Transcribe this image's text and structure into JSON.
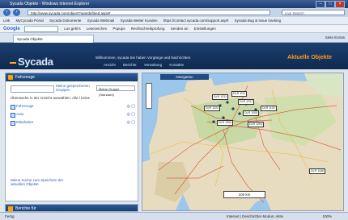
{
  "window": {
    "title": "Sycada Objekte - Windows Internet Explorer"
  },
  "address": {
    "url": "http://www.sycada.com/object?userdefined.aspx#",
    "live_search": "Live Search"
  },
  "links": [
    "Link",
    "MyCycada Portal",
    "Sycada Dokumente",
    "Sycada Webmail",
    "Sycada Weiter Kunden",
    "https://contact.sycada.com/support.asp#",
    "Sycada Bug & Issue tracking"
  ],
  "google_toolbar": {
    "label": "Google",
    "items": [
      "Los geht's",
      "Lesezeichen",
      "Popups",
      "Rechtschreibprüfung",
      "Senden an",
      "Einstellungen"
    ]
  },
  "tab": {
    "label": "Sycada Objekte",
    "tools": "Seite  Extras"
  },
  "app": {
    "logo": "Sycada",
    "welcome": "Willkommen, sycada   Sie haben Vorgänge und Nachrichten",
    "nav": [
      "Ansicht",
      "Berichte",
      "Verwaltung",
      "Kontakte"
    ],
    "headline": "Aktuelle Objekte"
  },
  "left_panel": {
    "title": "Fahrzeuge",
    "group_link": "Meine gespeicherten Gruppen",
    "group_select": "Meine Gruppe (Standard)",
    "list_heading": "Überwache in der Ansicht auswählen:  Alle / keine",
    "vehicles": [
      {
        "label": "Fahrzeuge",
        "actions": "◎ ▢"
      },
      {
        "label": "Auto",
        "actions": "◎ ▢"
      },
      {
        "label": "Mitarbeiter",
        "actions": "◎ ▢"
      }
    ],
    "save_link": "Meine Suche zum Speichern der aktuellen Objekte"
  },
  "bottom_panel": {
    "title": "Berichte für"
  },
  "map": {
    "tab": "Navigation",
    "scale": "100 km",
    "labels": [
      "DLR 1231",
      "DLR 1111",
      "DLR 1221",
      "DLR 1223",
      "DLR 1205",
      "DLR 1300",
      "DLR 1204",
      "DLR 1102",
      "DLR 1188"
    ]
  },
  "status": {
    "left": "Fertig",
    "zone": "Internet | Geschützter Modus: Aktiv",
    "zoom": "100%"
  }
}
